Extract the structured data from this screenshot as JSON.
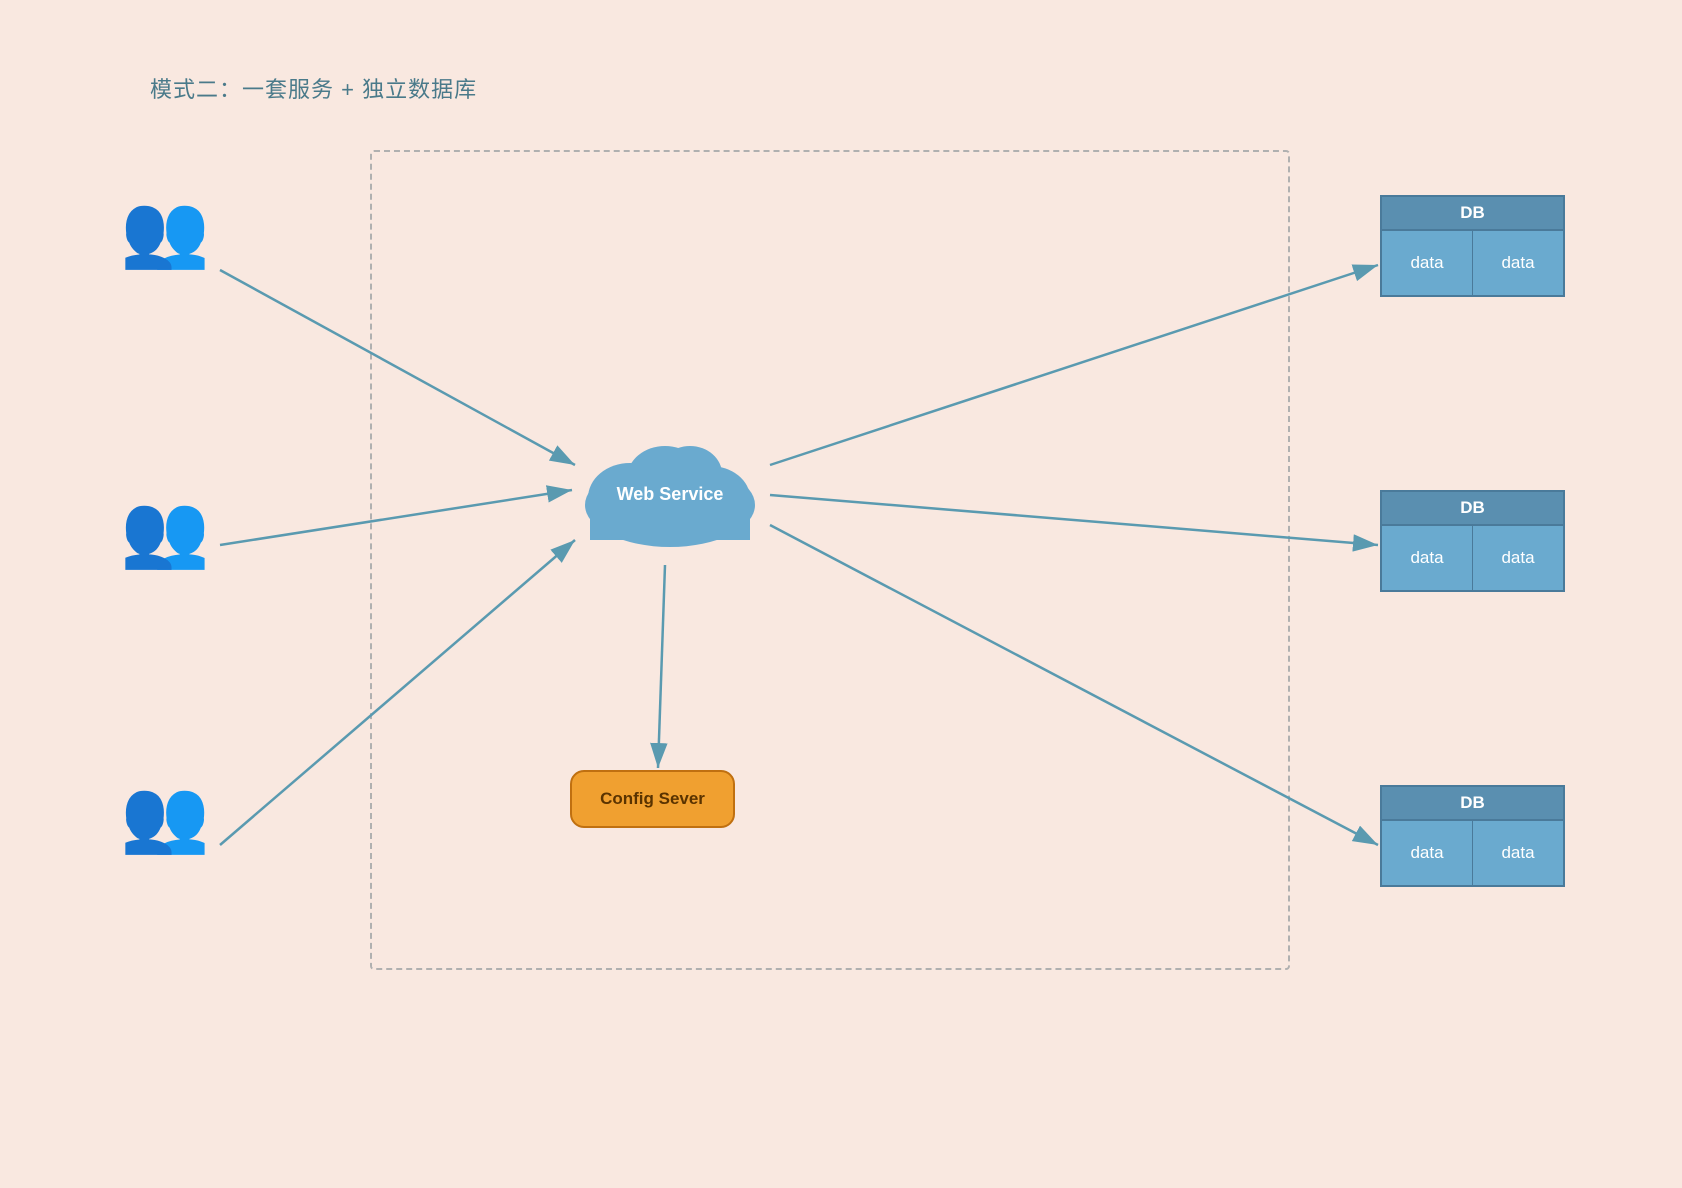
{
  "title": "模式二：一套服务 + 独立数据库",
  "cloud_label": "Web Service",
  "config_label": "Config Sever",
  "db_header": "DB",
  "db_cell_label": "data",
  "accent_color": "#e8931e",
  "db_color": "#5a8fb0",
  "arrow_color": "#5a9ab0",
  "user_groups": [
    {
      "id": 1
    },
    {
      "id": 2
    },
    {
      "id": 3
    }
  ],
  "dbs": [
    {
      "id": 1
    },
    {
      "id": 2
    },
    {
      "id": 3
    }
  ]
}
